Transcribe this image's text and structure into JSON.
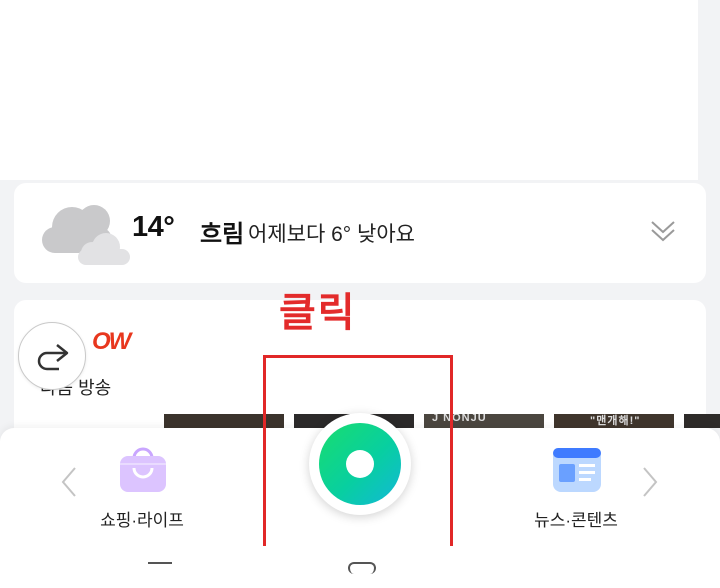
{
  "weather": {
    "temperature": "14°",
    "condition": "흐림",
    "comparison": "어제보다 6° 낮아요"
  },
  "annotation": {
    "label": "클릭",
    "color": "#e32b2b"
  },
  "news_preview": {
    "logo_fragment": "OW",
    "text_fragment": "다음 방송",
    "thumb_captions": [
      "",
      "",
      "J NONJU",
      "\"맨개해!\""
    ]
  },
  "bottom_nav": {
    "left_item": "쇼핑·라이프",
    "right_item": "뉴스·콘텐츠",
    "center_button": "green-circle-button"
  },
  "colors": {
    "accent_green": "#19dd6e",
    "accent_teal": "#12b8d8",
    "annotation_red": "#e12828"
  }
}
